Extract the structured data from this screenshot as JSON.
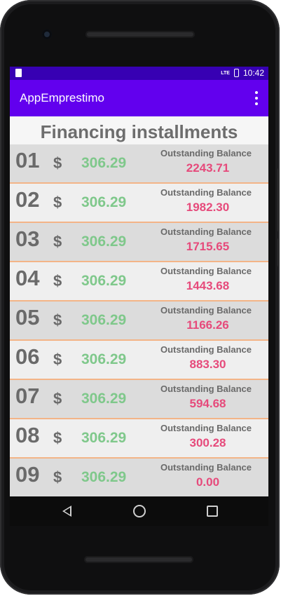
{
  "status_bar": {
    "network": "LTE",
    "time": "10:42"
  },
  "app_bar": {
    "title": "AppEmprestimo"
  },
  "list": {
    "title": "Financing installments",
    "currency_symbol": "$",
    "balance_label": "Outstanding Balance",
    "rows": [
      {
        "number": "01",
        "amount": "306.29",
        "balance": "2243.71"
      },
      {
        "number": "02",
        "amount": "306.29",
        "balance": "1982.30"
      },
      {
        "number": "03",
        "amount": "306.29",
        "balance": "1715.65"
      },
      {
        "number": "04",
        "amount": "306.29",
        "balance": "1443.68"
      },
      {
        "number": "05",
        "amount": "306.29",
        "balance": "1166.26"
      },
      {
        "number": "06",
        "amount": "306.29",
        "balance": "883.30"
      },
      {
        "number": "07",
        "amount": "306.29",
        "balance": "594.68"
      },
      {
        "number": "08",
        "amount": "306.29",
        "balance": "300.28"
      },
      {
        "number": "09",
        "amount": "306.29",
        "balance": "0.00"
      }
    ]
  },
  "colors": {
    "status_bar": "#3700b3",
    "app_bar": "#6200ee",
    "amount": "#7fc88b",
    "balance": "#e64a7b",
    "row_divider": "#f3b487"
  },
  "icons": {
    "overflow_menu": "more-vert-icon",
    "nav_back": "back-icon",
    "nav_home": "home-icon",
    "nav_recents": "recents-icon"
  }
}
